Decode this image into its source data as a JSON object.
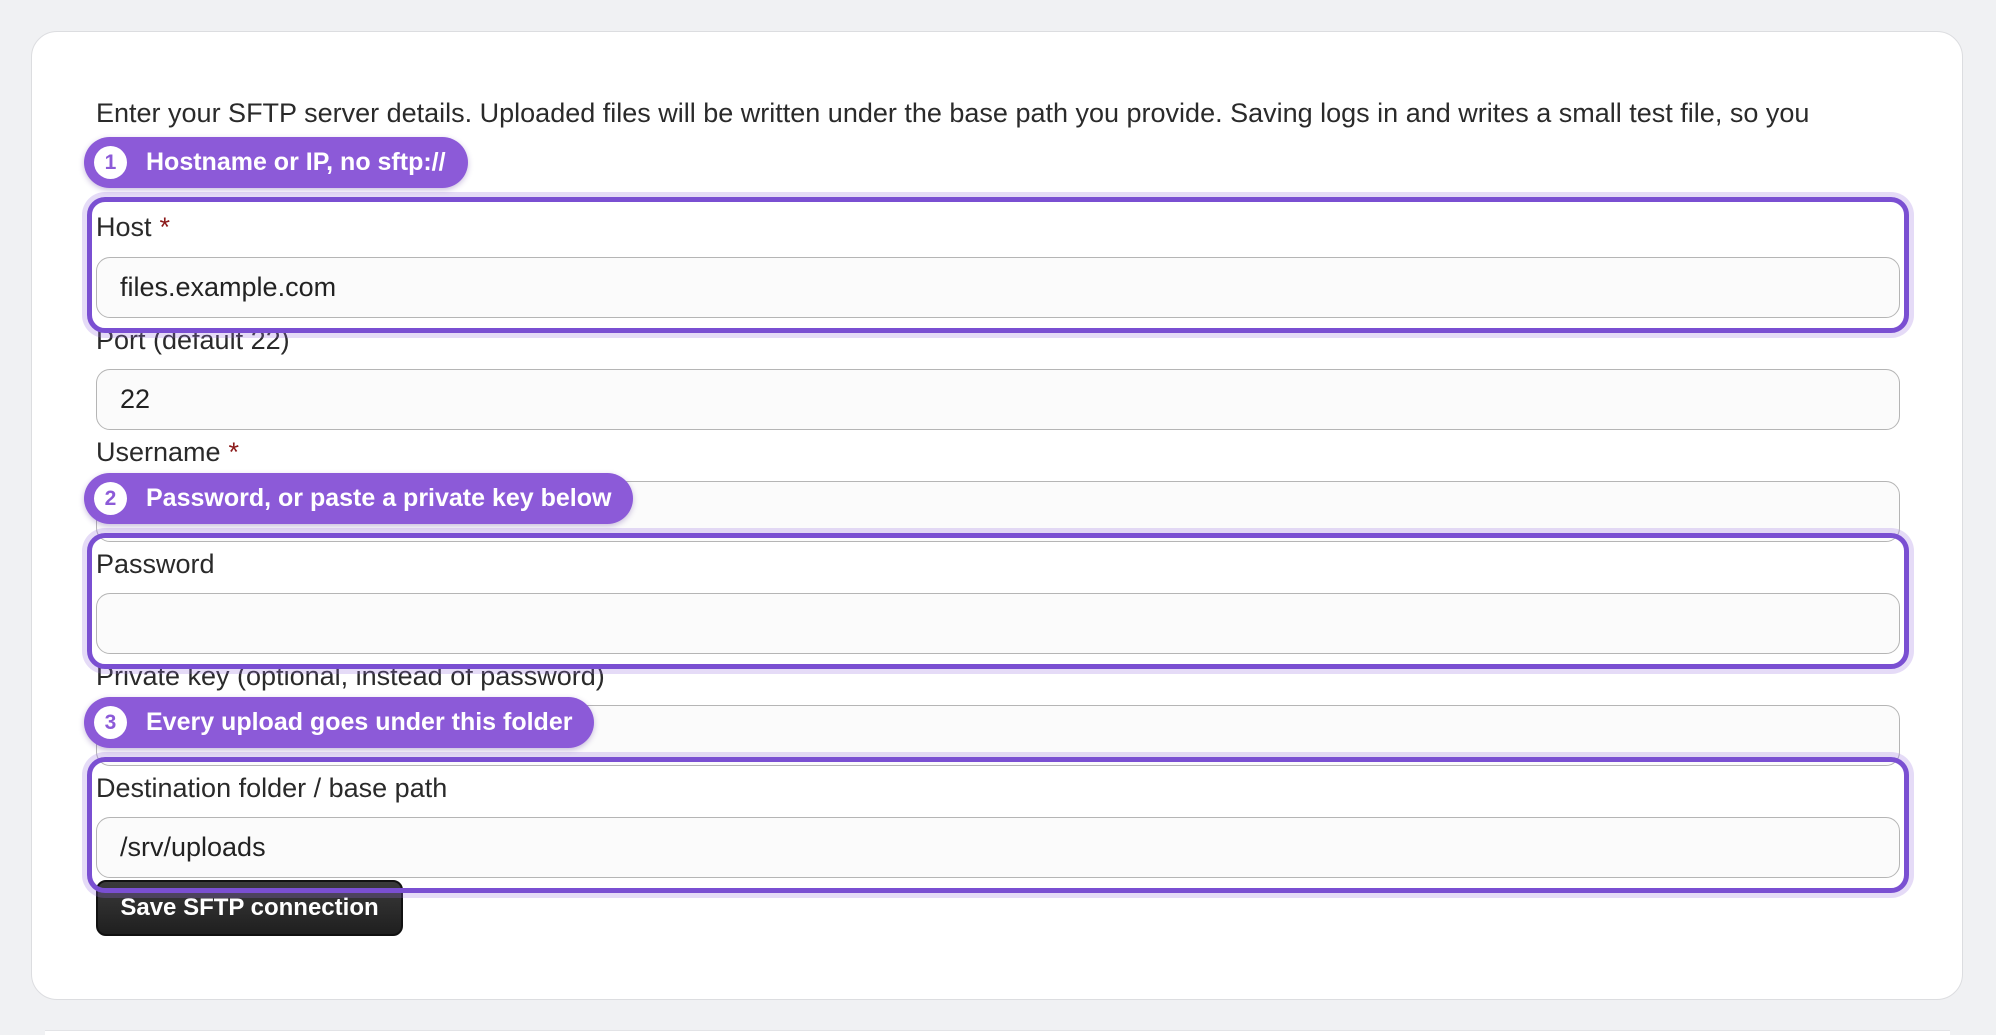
{
  "intro_text": "Enter your SFTP server details. Uploaded files will be written under the base path you provide. Saving logs in and writes a small test file, so you",
  "fields": {
    "host": {
      "label": "Host",
      "required_mark": "*",
      "value": "files.example.com"
    },
    "port": {
      "label": "Port (default 22)",
      "value": "22"
    },
    "username": {
      "label": "Username",
      "required_mark": "*",
      "value": ""
    },
    "password": {
      "label": "Password",
      "value": ""
    },
    "private_key": {
      "label": "Private key (optional, instead of password)",
      "value": ""
    },
    "base_path": {
      "label": "Destination folder / base path",
      "value": "/srv/uploads"
    }
  },
  "callouts": [
    {
      "number": "1",
      "text": "Hostname or IP, no sftp://"
    },
    {
      "number": "2",
      "text": "Password, or paste a private key below"
    },
    {
      "number": "3",
      "text": "Every upload goes under this folder"
    }
  ],
  "save_button_label": "Save SFTP connection",
  "colors": {
    "callout": "#8c5ad8",
    "highlight_border": "#7a4fd2",
    "required": "#8b1a1a",
    "button": "#2a2a2a"
  }
}
